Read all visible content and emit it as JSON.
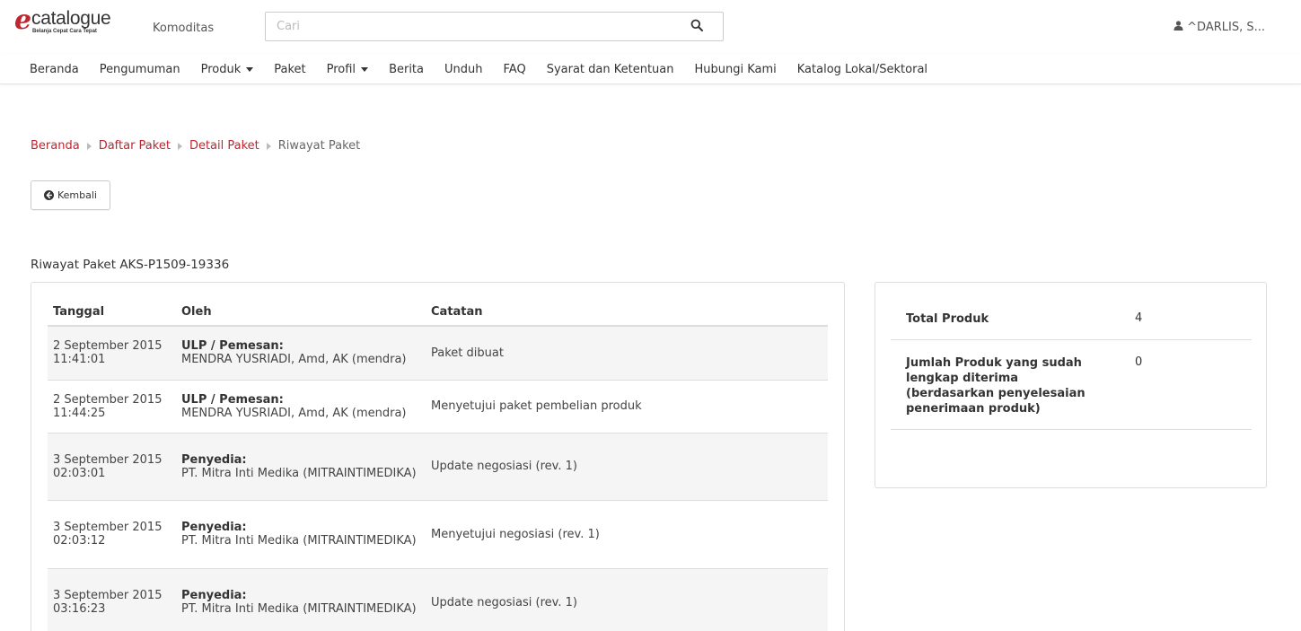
{
  "header": {
    "logo_word": "catalogue",
    "logo_letter": "e",
    "logo_tagline": "Belanja Cepat Cara Tepat",
    "komoditas_label": "Komoditas",
    "search_placeholder": "Cari",
    "user_name": "^DARLIS, S..."
  },
  "nav": {
    "items": [
      {
        "label": "Beranda",
        "dropdown": false
      },
      {
        "label": "Pengumuman",
        "dropdown": false
      },
      {
        "label": "Produk",
        "dropdown": true
      },
      {
        "label": "Paket",
        "dropdown": false
      },
      {
        "label": "Profil",
        "dropdown": true
      },
      {
        "label": "Berita",
        "dropdown": false
      },
      {
        "label": "Unduh",
        "dropdown": false
      },
      {
        "label": "FAQ",
        "dropdown": false
      },
      {
        "label": "Syarat dan Ketentuan",
        "dropdown": false
      },
      {
        "label": "Hubungi Kami",
        "dropdown": false
      },
      {
        "label": "Katalog Lokal/Sektoral",
        "dropdown": false
      }
    ]
  },
  "breadcrumb": {
    "items": [
      "Beranda",
      "Daftar Paket",
      "Detail Paket"
    ],
    "current": "Riwayat Paket"
  },
  "back_button": {
    "label": "Kembali"
  },
  "history": {
    "title": "Riwayat Paket AKS-P1509-19336",
    "columns": [
      "Tanggal",
      "Oleh",
      "Catatan"
    ],
    "rows": [
      {
        "date": "2 September 2015",
        "time": "11:41:01",
        "role": "ULP / Pemesan:",
        "name": "MENDRA YUSRIADI, Amd, AK (mendra)",
        "note": "Paket dibuat"
      },
      {
        "date": "2 September 2015",
        "time": "11:44:25",
        "role": "ULP / Pemesan:",
        "name": "MENDRA YUSRIADI, Amd, AK (mendra)",
        "note": "Menyetujui paket pembelian produk"
      },
      {
        "date": "3 September 2015",
        "time": "02:03:01",
        "role": "Penyedia:",
        "name": "PT. Mitra Inti Medika (MITRAINTIMEDIKA)",
        "note": "Update negosiasi (rev. 1)"
      },
      {
        "date": "3 September 2015",
        "time": "02:03:12",
        "role": "Penyedia:",
        "name": "PT. Mitra Inti Medika (MITRAINTIMEDIKA)",
        "note": "Menyetujui negosiasi (rev. 1)"
      },
      {
        "date": "3 September 2015",
        "time": "03:16:23",
        "role": "Penyedia:",
        "name": "PT. Mitra Inti Medika (MITRAINTIMEDIKA)",
        "note": "Update negosiasi (rev. 1)"
      }
    ]
  },
  "summary": {
    "rows": [
      {
        "label": "Total Produk",
        "value": "4"
      },
      {
        "label": "Jumlah Produk yang sudah lengkap diterima (berdasarkan penyelesaian penerimaan produk)",
        "value": "0"
      }
    ]
  },
  "colors": {
    "brand": "#c0262e",
    "text": "#333333",
    "stripe": "#f5f5f5"
  }
}
